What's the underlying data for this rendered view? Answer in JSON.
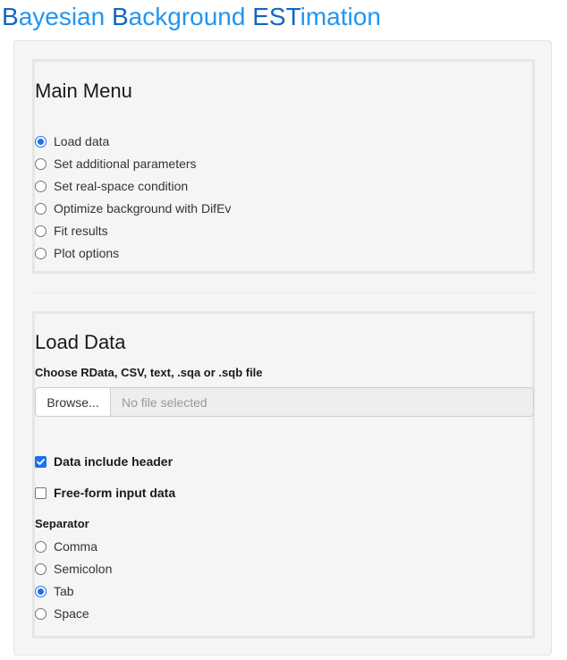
{
  "app": {
    "title_parts": [
      "B",
      "ayesian ",
      "B",
      "ackground ",
      "EST",
      "imation"
    ]
  },
  "main_menu": {
    "heading": "Main Menu",
    "options": [
      {
        "label": "Load data",
        "selected": true
      },
      {
        "label": "Set additional parameters",
        "selected": false
      },
      {
        "label": "Set real-space condition",
        "selected": false
      },
      {
        "label": "Optimize background with DifEv",
        "selected": false
      },
      {
        "label": "Fit results",
        "selected": false
      },
      {
        "label": "Plot options",
        "selected": false
      }
    ]
  },
  "load_data": {
    "heading": "Load Data",
    "file_label": "Choose RData, CSV, text, .sqa or .sqb file",
    "browse_label": "Browse...",
    "file_placeholder": "No file selected",
    "header_checkbox": {
      "label": "Data include header",
      "checked": true
    },
    "freeform_checkbox": {
      "label": "Free-form input data",
      "checked": false
    },
    "separator_label": "Separator",
    "separator_options": [
      {
        "label": "Comma",
        "selected": false
      },
      {
        "label": "Semicolon",
        "selected": false
      },
      {
        "label": "Tab",
        "selected": true
      },
      {
        "label": "Space",
        "selected": false
      }
    ]
  },
  "colors": {
    "accent": "#1a73e8",
    "title_light": "#2196f3",
    "title_dark": "#1565c0",
    "panel_bg": "#f5f5f5"
  }
}
